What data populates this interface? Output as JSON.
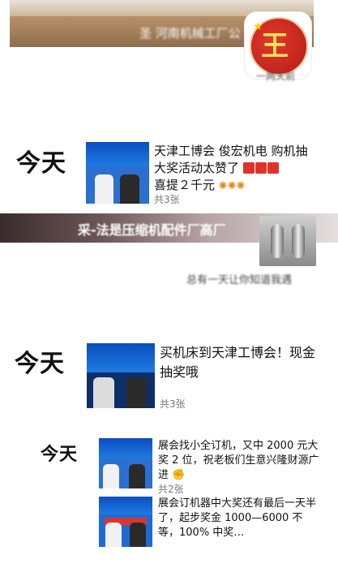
{
  "top_post": {
    "caption": "圣 河南机械工厂公",
    "avatar_glyph": "王",
    "avatar_star": "★",
    "avatar_note": "一两天前"
  },
  "posts": [
    {
      "day": "今天",
      "text": "天津工博会 俊宏机电 购机抽大奖活动太赞了",
      "text_line2": "喜提２千元",
      "count": "共3张"
    },
    {
      "video_caption": "采-法是压缩机配件厂高厂",
      "video_note": "总有一天让你知道我遇"
    },
    {
      "day": "今天",
      "text": "买机床到天津工博会！现金抽奖哦",
      "count": "共3张"
    },
    {
      "day": "今天",
      "entries": [
        {
          "text": "展会找小全订机，又中 2000 元大奖 2 位，祝老板们生意兴隆财源广进",
          "count": "共2张"
        },
        {
          "text": "展会订机器中大奖还有最后一天半了，起步奖金 1000—6000 不等，100% 中奖…"
        }
      ]
    }
  ]
}
